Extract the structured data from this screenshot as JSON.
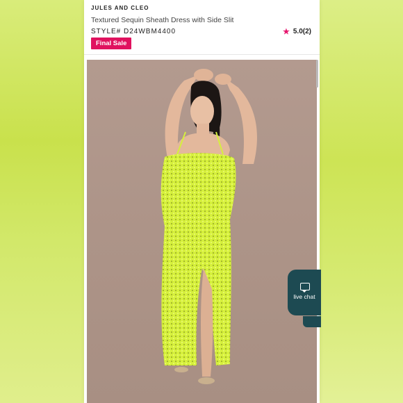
{
  "product": {
    "brand": "JULES AND CLEO",
    "title": "Textured Sequin Sheath Dress with Side Slit",
    "style": "STYLE# D24WBM4400",
    "rating": "5.0(2)",
    "badge": "Final Sale"
  },
  "chat": {
    "label": "live chat",
    "icon": "chat-bubble-icon"
  },
  "colors": {
    "accent": "#e0125f",
    "star": "#e6176e",
    "chat": "#1d4a52",
    "dress": "#d6f03c"
  }
}
